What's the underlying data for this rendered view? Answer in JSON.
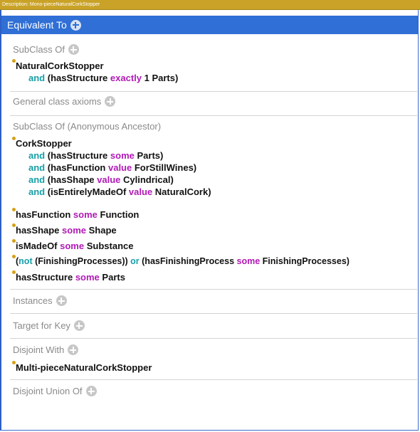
{
  "description_bar": "Description: Mono-pieceNaturalCorkStopper",
  "sections": {
    "equivalent_to": "Equivalent To",
    "subclass_of": "SubClass Of",
    "general_class_axioms": "General class axioms",
    "subclass_of_anonymous": "SubClass Of (Anonymous Ancestor)",
    "instances": "Instances",
    "target_for_key": "Target for Key",
    "disjoint_with": "Disjoint With",
    "disjoint_union_of": "Disjoint Union Of"
  },
  "subclass_of": {
    "line1": "NaturalCorkStopper",
    "line2_and": "and",
    "line2_a": "(hasStructure",
    "line2_kw": "exactly",
    "line2_b": "1 Parts)"
  },
  "anon": {
    "cork": "CorkStopper",
    "l1_and": "and",
    "l1_a": "(hasStructure",
    "l1_kw": "some",
    "l1_b": "Parts)",
    "l2_and": "and",
    "l2_a": "(hasFunction",
    "l2_kw": "value",
    "l2_b": "ForStillWines)",
    "l3_and": "and",
    "l3_a": "(hasShape",
    "l3_kw": "value",
    "l3_b": "Cylindrical)",
    "l4_and": "and",
    "l4_a": "(isEntirelyMadeOf",
    "l4_kw": "value",
    "l4_b": "NaturalCork)",
    "hf_a": "hasFunction",
    "hf_kw": "some",
    "hf_b": "Function",
    "hs_a": "hasShape",
    "hs_kw": "some",
    "hs_b": "Shape",
    "im_a": "isMadeOf",
    "im_kw": "some",
    "im_b": "Substance",
    "fp_open": "(",
    "fp_not": "not",
    "fp_mid": " (FinishingProcesses))",
    "fp_or": "or",
    "fp_c": "(hasFinishingProcess",
    "fp_kw": "some",
    "fp_d": "FinishingProcesses)",
    "st_a": "hasStructure",
    "st_kw": "some",
    "st_b": "Parts"
  },
  "disjoint_with": {
    "item": "Multi-pieceNaturalCorkStopper"
  },
  "colors": {
    "keyword_cyan": "#169fa8",
    "keyword_magenta": "#b01ab5",
    "header_blue": "#2f6fd6",
    "bullet_gold": "#d4a017",
    "desc_bar": "#c9a227"
  }
}
